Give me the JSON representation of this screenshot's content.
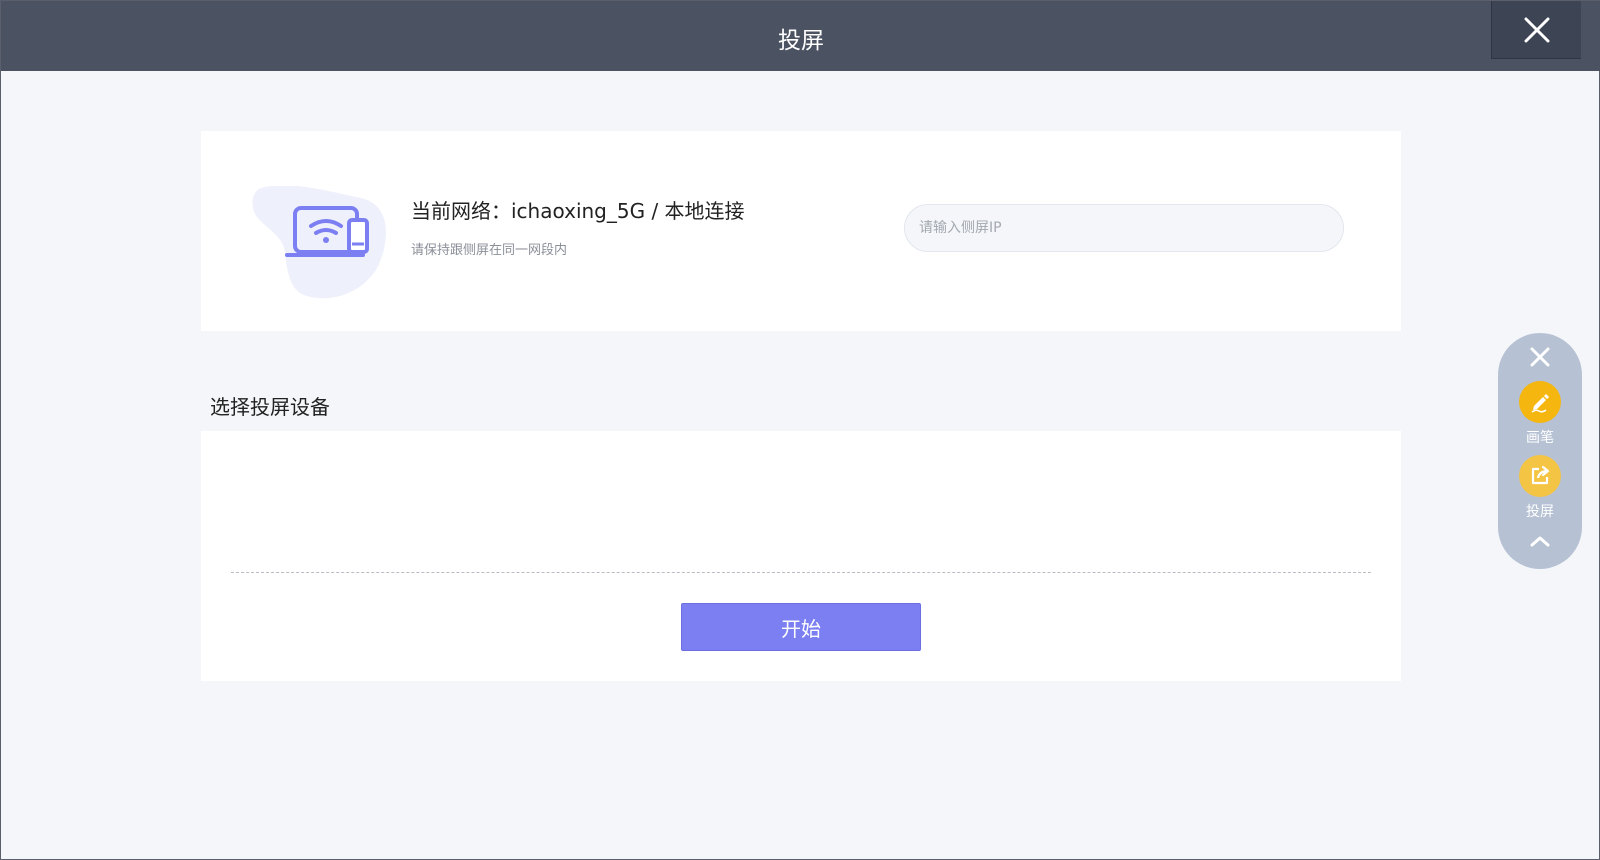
{
  "window": {
    "title": "投屏"
  },
  "network": {
    "title": "当前网络：ichaoxing_5G / 本地连接",
    "hint": "请保持跟侧屏在同一网段内",
    "ip_placeholder": "请输入侧屏IP",
    "ip_value": ""
  },
  "devices": {
    "section_title": "选择投屏设备",
    "items": [],
    "start_label": "开始"
  },
  "float_toolbar": {
    "pen_label": "画笔",
    "cast_label": "投屏"
  },
  "colors": {
    "titlebar": "#4b5262",
    "accent": "#7b7ff2",
    "toolbar_bg": "#b6c2d4",
    "pen_circle": "#f5b60f",
    "cast_circle": "#f4c444"
  },
  "icons": {
    "window_close": "close-icon",
    "illustration": "laptop-wifi-icon",
    "toolbar_close": "close-icon",
    "pen": "pen-icon",
    "cast": "share-icon",
    "collapse": "chevron-up-icon"
  }
}
